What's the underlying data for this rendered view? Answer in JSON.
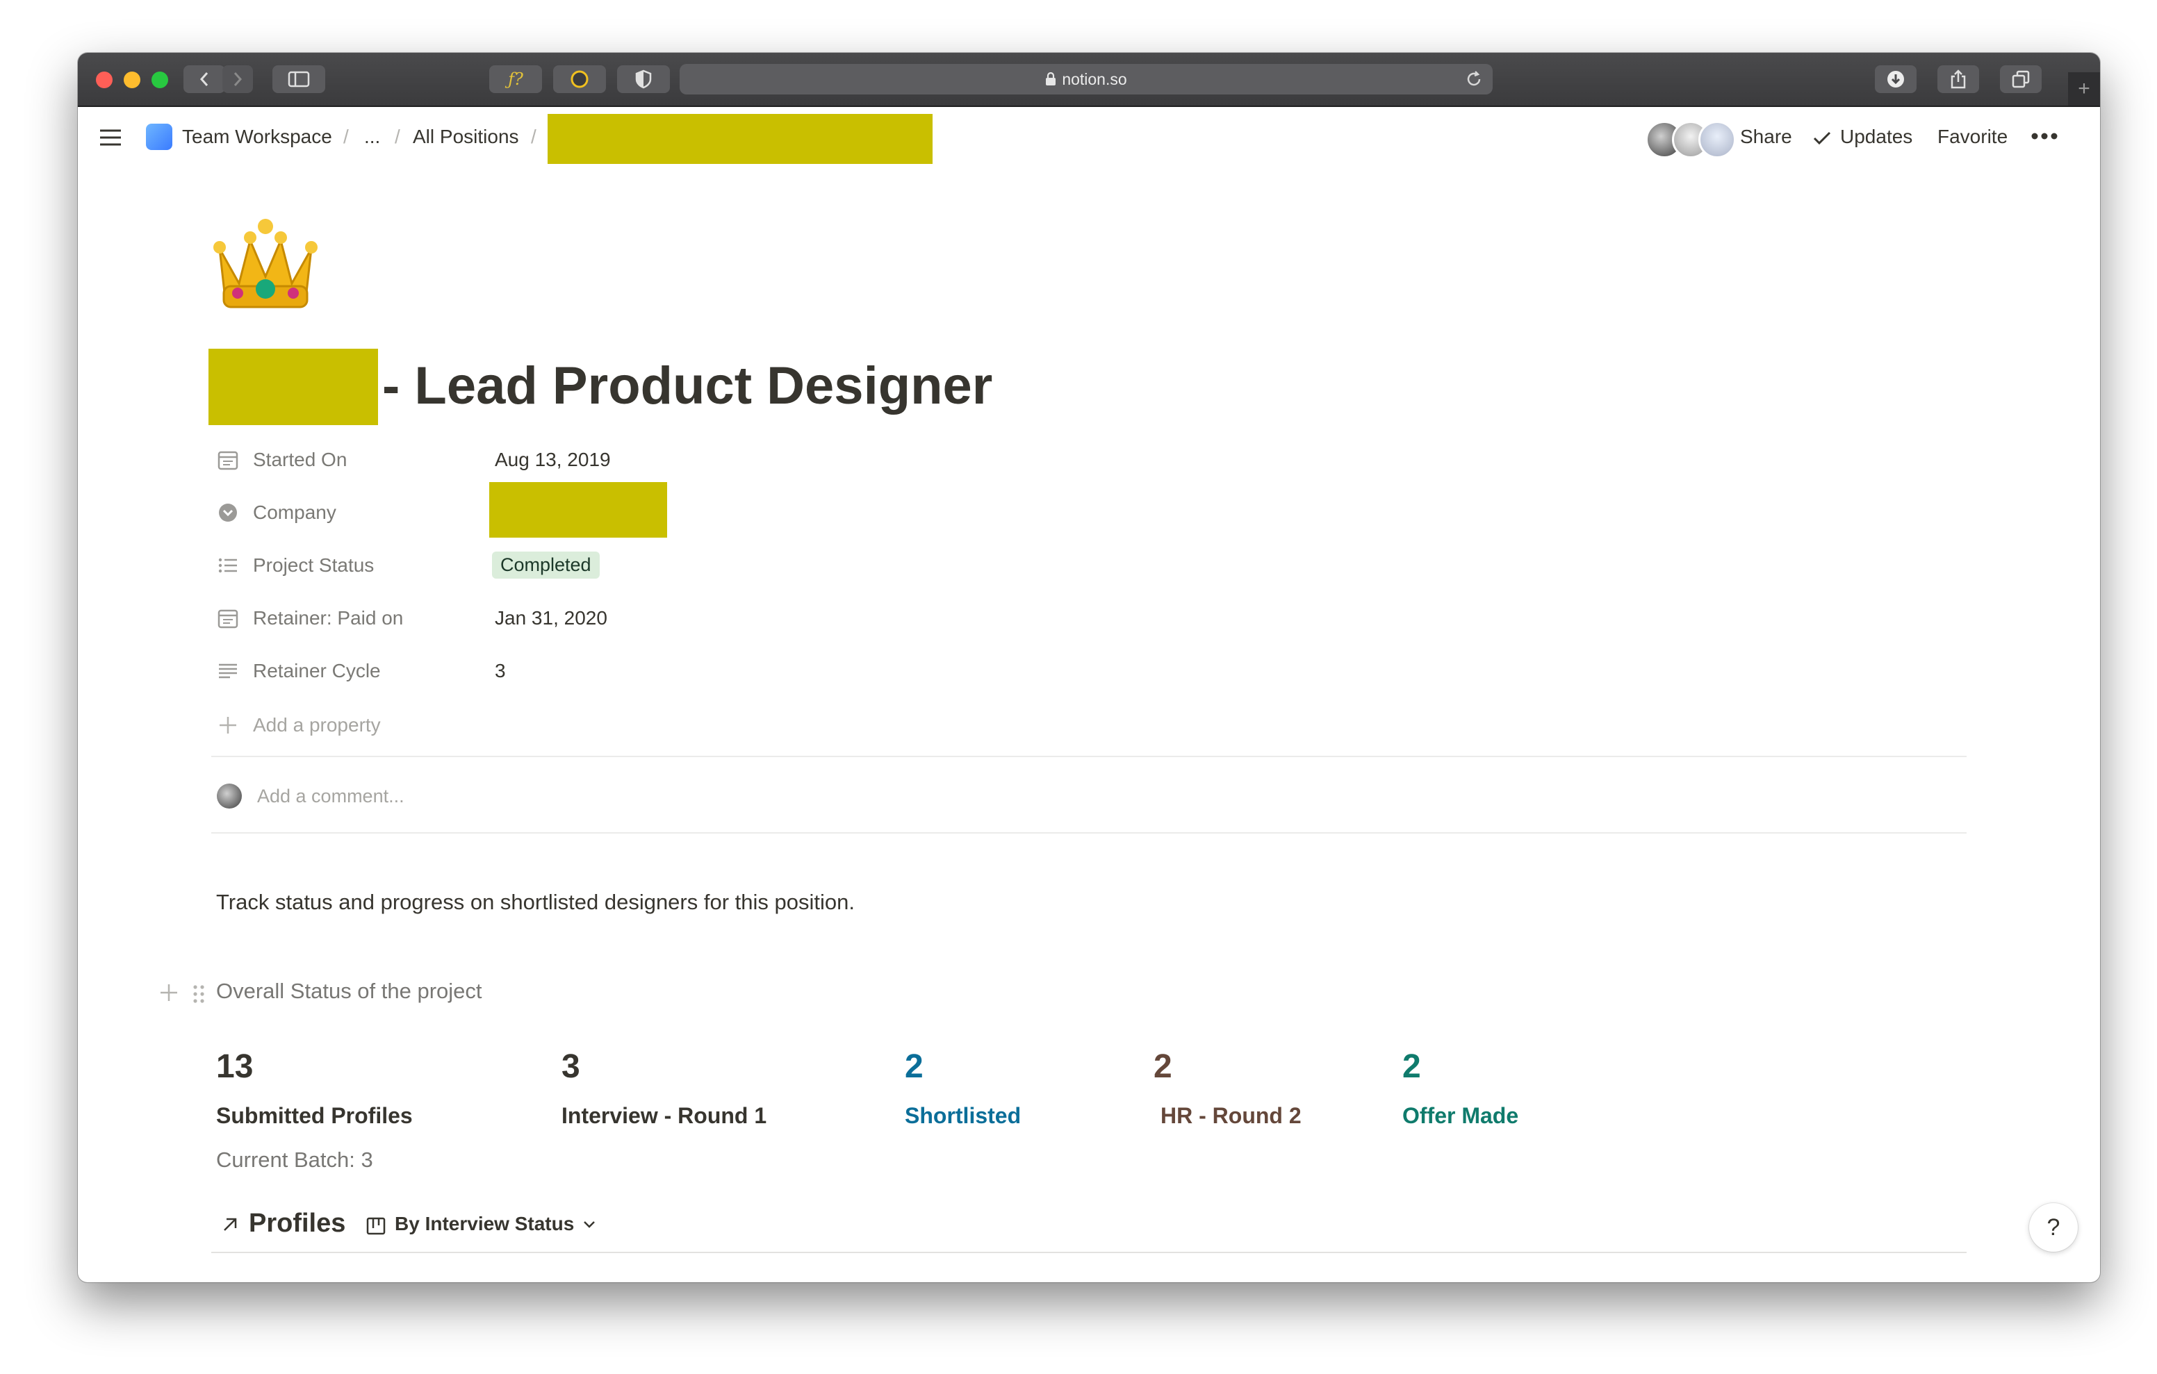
{
  "browser": {
    "url": "notion.so"
  },
  "breadcrumb": {
    "workspace": "Team Workspace",
    "ellipsis": "...",
    "parent": "All Positions",
    "separator": "/"
  },
  "topbar": {
    "share": "Share",
    "updates": "Updates",
    "favorite": "Favorite"
  },
  "page": {
    "icon": "crown-emoji",
    "title_suffix": "- Lead Product Designer",
    "properties": [
      {
        "label": "Started On",
        "value": "Aug 13, 2019",
        "icon": "calendar-icon"
      },
      {
        "label": "Company",
        "value": "",
        "icon": "relation-icon"
      },
      {
        "label": "Project Status",
        "value": "Completed",
        "icon": "list-icon"
      },
      {
        "label": "Retainer: Paid on",
        "value": "Jan 31, 2020",
        "icon": "calendar-icon"
      },
      {
        "label": "Retainer Cycle",
        "value": "3",
        "icon": "text-icon"
      }
    ],
    "add_property": "Add a property",
    "comment_placeholder": "Add a comment...",
    "description": "Track status and progress on shortlisted designers for this position.",
    "section_heading": "Overall Status of the project",
    "stats": [
      {
        "number": "13",
        "label": "Submitted Profiles",
        "color": "#37352f"
      },
      {
        "number": "3",
        "label": "Interview - Round 1",
        "color": "#37352f"
      },
      {
        "number": "2",
        "label": "Shortlisted",
        "color": "#0b6e99"
      },
      {
        "number": "2",
        "label": "HR - Round 2",
        "color": "#64473a"
      },
      {
        "number": "2",
        "label": "Offer Made",
        "color": "#0f7b6c"
      }
    ],
    "current_batch": "Current Batch: 3",
    "database": {
      "title": "Profiles",
      "view": "By Interview Status"
    },
    "help": "?"
  },
  "colors": {
    "redaction": "#c9bf00",
    "status_pill_bg": "#dbeddb"
  }
}
